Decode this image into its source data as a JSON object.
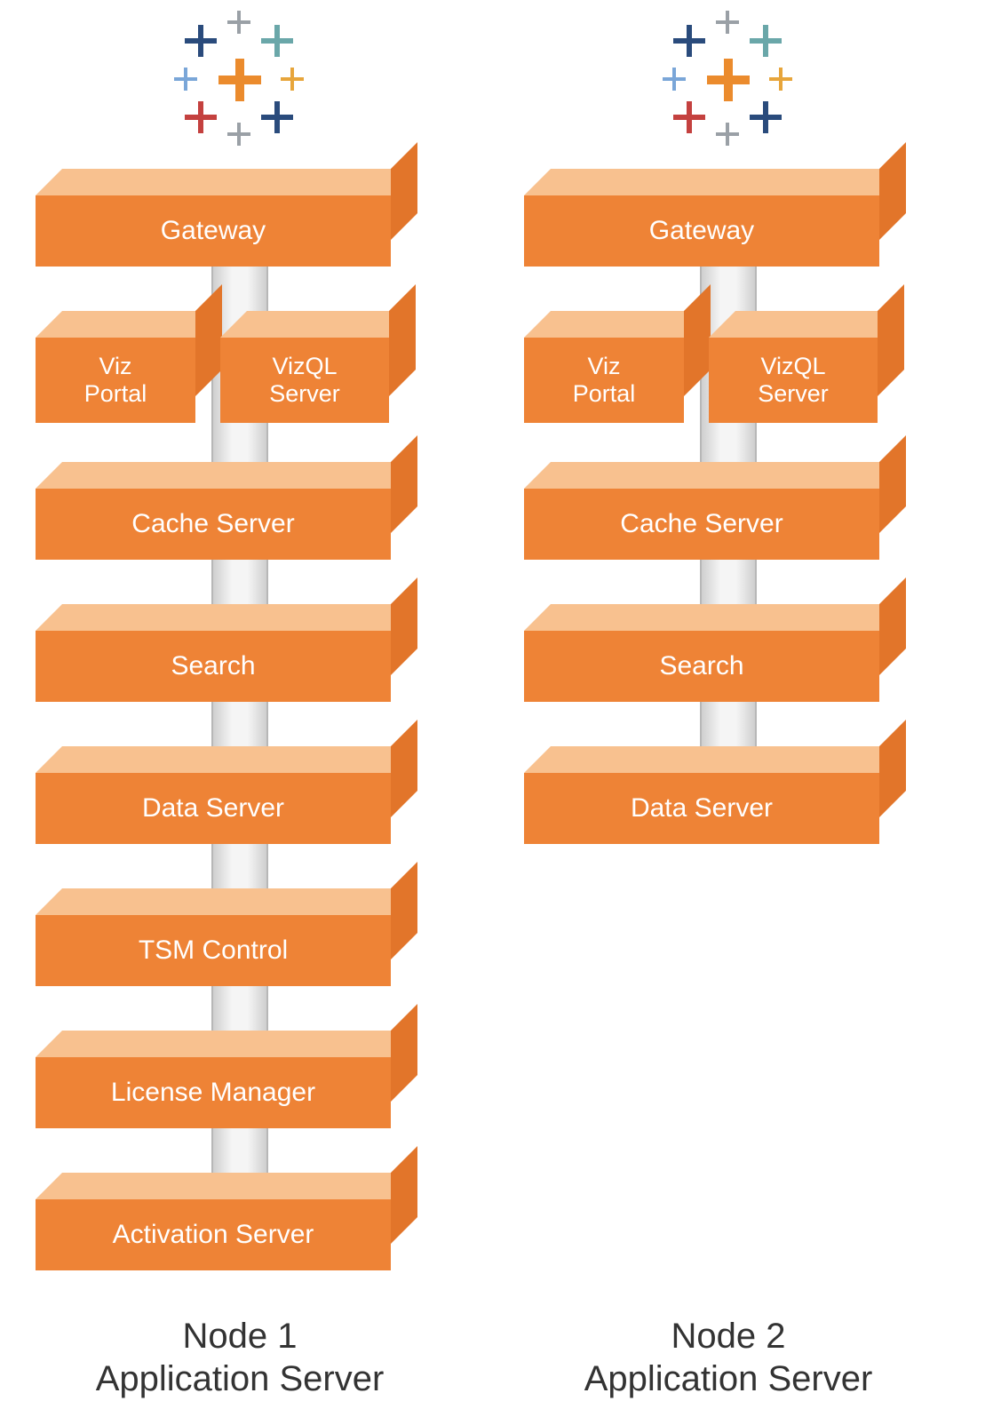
{
  "nodes": [
    {
      "caption_line1": "Node 1",
      "caption_line2": "Application Server",
      "pair": {
        "left": "Viz\nPortal",
        "right": "VizQL\nServer"
      },
      "blocks": [
        "Gateway",
        "Cache Server",
        "Search",
        "Data Server",
        "TSM Control",
        "License Manager",
        "Activation Server"
      ]
    },
    {
      "caption_line1": "Node 2",
      "caption_line2": "Application Server",
      "pair": {
        "left": "Viz\nPortal",
        "right": "VizQL\nServer"
      },
      "blocks": [
        "Gateway",
        "Cache Server",
        "Search",
        "Data Server"
      ]
    }
  ],
  "colors": {
    "block_light": "#f8c18f",
    "block_mid": "#ee8336",
    "block_dark": "#e2752a"
  }
}
